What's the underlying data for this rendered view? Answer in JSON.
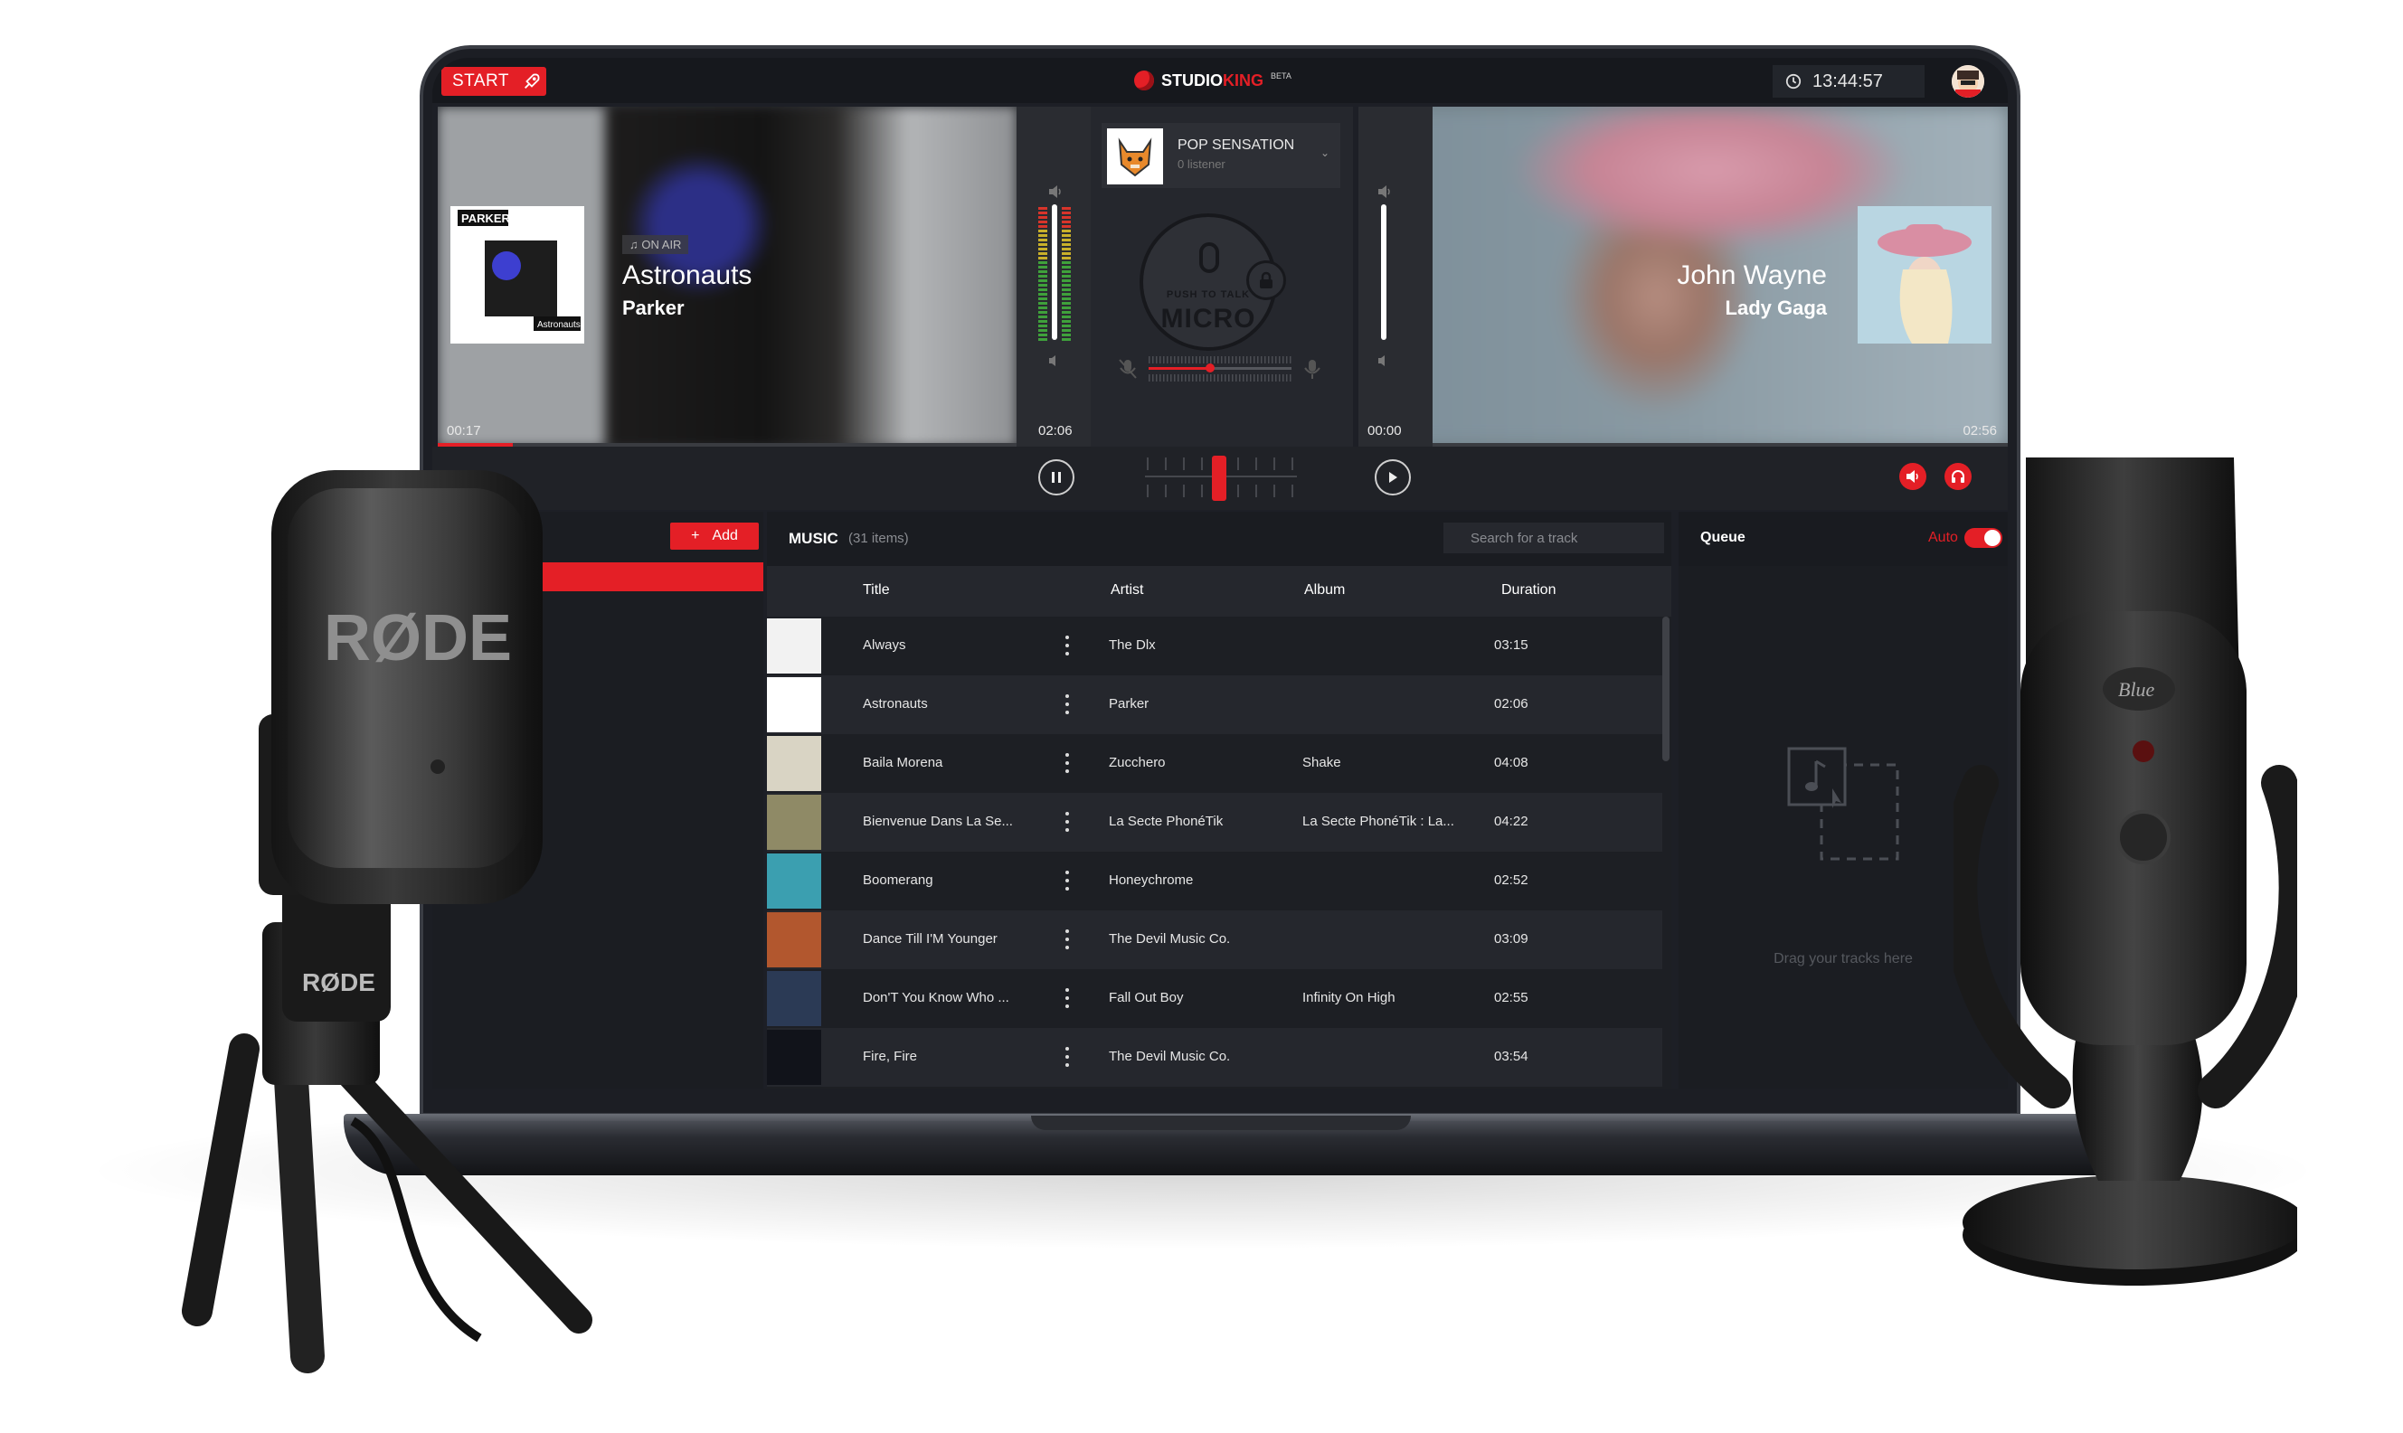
{
  "topbar": {
    "start_label": "START",
    "logo_studio": "STUDIO",
    "logo_king": "KING",
    "logo_beta": "BETA",
    "clock": "13:44:57"
  },
  "deck_a": {
    "badge": "ON AIR",
    "title": "Astronauts",
    "artist": "Parker",
    "elapsed": "00:17",
    "duration": "02:06",
    "progress": 0.13,
    "cover_band": "PARKER",
    "cover_caption": "Astronauts"
  },
  "deck_b": {
    "title": "John Wayne",
    "artist": "Lady Gaga",
    "elapsed": "00:00",
    "duration": "02:56",
    "progress": 0.0
  },
  "channel": {
    "name": "POP SENSATION",
    "listeners": "0 listener"
  },
  "mic": {
    "push_label": "PUSH TO TALK",
    "big_label": "MICRO"
  },
  "library": {
    "add_label": "Add"
  },
  "music": {
    "title": "MUSIC",
    "count": "(31 items)",
    "search_placeholder": "Search for a track",
    "columns": {
      "title": "Title",
      "artist": "Artist",
      "album": "Album",
      "duration": "Duration"
    },
    "tracks": [
      {
        "title": "Always",
        "artist": "The Dlx",
        "album": "",
        "duration": "03:15",
        "thumb_color": "#f2f2f2"
      },
      {
        "title": "Astronauts",
        "artist": "Parker",
        "album": "",
        "duration": "02:06",
        "thumb_color": "#ffffff"
      },
      {
        "title": "Baila Morena",
        "artist": "Zucchero",
        "album": "Shake",
        "duration": "04:08",
        "thumb_color": "#d9d4c4"
      },
      {
        "title": "Bienvenue Dans La Se...",
        "artist": "La Secte PhonéTik",
        "album": "La Secte PhonéTik : La...",
        "duration": "04:22",
        "thumb_color": "#8f8a66"
      },
      {
        "title": "Boomerang",
        "artist": "Honeychrome",
        "album": "",
        "duration": "02:52",
        "thumb_color": "#3b9fb0"
      },
      {
        "title": "Dance Till I'M Younger",
        "artist": "The Devil Music Co.",
        "album": "",
        "duration": "03:09",
        "thumb_color": "#b2572e"
      },
      {
        "title": "Don'T You Know Who ...",
        "artist": "Fall Out Boy",
        "album": "Infinity On High",
        "duration": "02:55",
        "thumb_color": "#2b3a55"
      },
      {
        "title": "Fire, Fire",
        "artist": "The Devil Music Co.",
        "album": "",
        "duration": "03:54",
        "thumb_color": "#11131a"
      }
    ]
  },
  "queue": {
    "title": "Queue",
    "auto_label": "Auto",
    "auto_on": true,
    "drop_text": "Drag your tracks here"
  },
  "colors": {
    "accent": "#e41f26",
    "panel": "#1d1f24",
    "row_alt": "#25272d"
  },
  "microphones": {
    "left_brand": "RØDE",
    "left_brand_small": "RØDE",
    "right_brand": "Blue"
  }
}
